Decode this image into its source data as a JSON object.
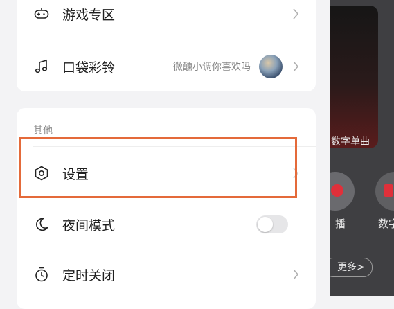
{
  "menu_top": {
    "items": [
      {
        "label": "游戏专区"
      },
      {
        "label": "口袋彩铃",
        "subtitle": "微醺小调你喜欢吗"
      }
    ]
  },
  "menu_other": {
    "section_title": "其他",
    "items": [
      {
        "label": "设置"
      },
      {
        "label": "夜间模式",
        "toggle_on": false
      },
      {
        "label": "定时关闭"
      }
    ]
  },
  "background": {
    "card_label": "数字单曲",
    "circle_label_1": "播",
    "circle_label_2": "数字",
    "more_label": "更多>"
  },
  "colors": {
    "highlight": "#e46a3a",
    "panel_bg": "#f3f3f5",
    "card_bg": "#ffffff"
  }
}
